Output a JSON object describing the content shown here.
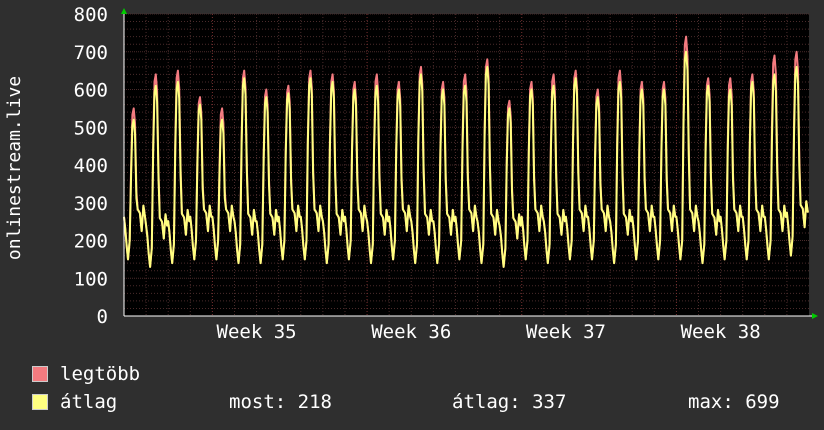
{
  "chart_data": {
    "type": "line",
    "ylabel": "onlinestream.live",
    "ylim": [
      0,
      800
    ],
    "y_ticks": [
      0,
      100,
      200,
      300,
      400,
      500,
      600,
      700,
      800
    ],
    "x_ticks": [
      "Week 35",
      "Week 36",
      "Week 37",
      "Week 38"
    ],
    "grid": true,
    "num_days": 31,
    "series": [
      {
        "name": "legtöbb",
        "color": "#f47b80",
        "daily_peaks": [
          550,
          640,
          650,
          580,
          550,
          650,
          600,
          610,
          650,
          640,
          620,
          640,
          620,
          660,
          620,
          640,
          680,
          570,
          620,
          640,
          650,
          600,
          650,
          620,
          620,
          740,
          630,
          630,
          640,
          690,
          700
        ],
        "daily_troughs": [
          150,
          130,
          140,
          150,
          150,
          140,
          140,
          150,
          150,
          140,
          150,
          140,
          150,
          140,
          140,
          150,
          140,
          130,
          150,
          140,
          150,
          150,
          140,
          150,
          150,
          150,
          140,
          150,
          150,
          150,
          160
        ]
      },
      {
        "name": "átlag",
        "color": "#ffff80",
        "daily_peaks": [
          520,
          610,
          620,
          560,
          520,
          630,
          580,
          590,
          630,
          620,
          600,
          610,
          600,
          640,
          600,
          610,
          660,
          550,
          600,
          610,
          630,
          580,
          620,
          600,
          600,
          700,
          610,
          600,
          620,
          640,
          660
        ],
        "daily_troughs": [
          150,
          130,
          140,
          150,
          150,
          140,
          140,
          150,
          150,
          140,
          150,
          140,
          150,
          140,
          140,
          150,
          140,
          130,
          150,
          140,
          150,
          150,
          140,
          150,
          150,
          150,
          140,
          150,
          150,
          150,
          160
        ]
      }
    ]
  },
  "legend": {
    "max_label": "legtöbb",
    "avg_label": "átlag",
    "now": "most: 218",
    "average": "átlag: 337",
    "maximum": "max: 699"
  },
  "colors": {
    "background": "#2f2f2f",
    "plot_background": "#000000",
    "grid": "#4a2b2b",
    "text": "#ffffff",
    "arrow": "#00cc00"
  }
}
